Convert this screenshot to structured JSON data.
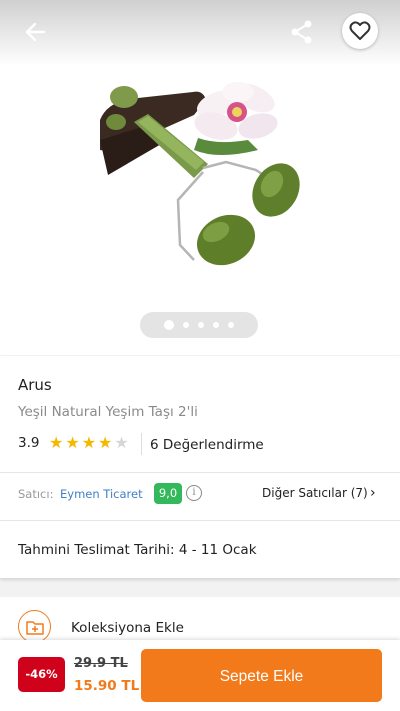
{
  "header": {
    "back_icon": "arrow-left-icon",
    "share_icon": "share-icon",
    "favorite_icon": "heart-outline-icon"
  },
  "gallery": {
    "image_description": "green jade facial roller with flower",
    "dot_count": 5,
    "active_dot": 0
  },
  "product": {
    "brand": "Arus",
    "name": "Yeşil Natural Yeşim Taşı 2'li",
    "rating": "3.9",
    "stars_filled": 4,
    "stars_total": 5,
    "reviews": "6 Değerlendirme"
  },
  "seller": {
    "label": "Satıcı:",
    "name": "Eymen Ticaret",
    "score": "9,0",
    "info_icon": "i",
    "other_sellers": "Diğer Satıcılar (7)",
    "chevron": "›"
  },
  "delivery": {
    "text": "Tahmini Teslimat Tarihi: 4 - 11 Ocak"
  },
  "collection": {
    "label": "Koleksiyona Ekle",
    "icon": "folder-add-icon"
  },
  "purchase": {
    "discount": "-46%",
    "old_price": "29.9 TL",
    "new_price": "15.90 TL",
    "add_to_cart": "Sepete Ekle"
  },
  "colors": {
    "accent": "#f27a1a",
    "discount_red": "#d0021b",
    "seller_link": "#3f7fc6",
    "score_green": "#33b85c",
    "star": "#f5b800"
  }
}
